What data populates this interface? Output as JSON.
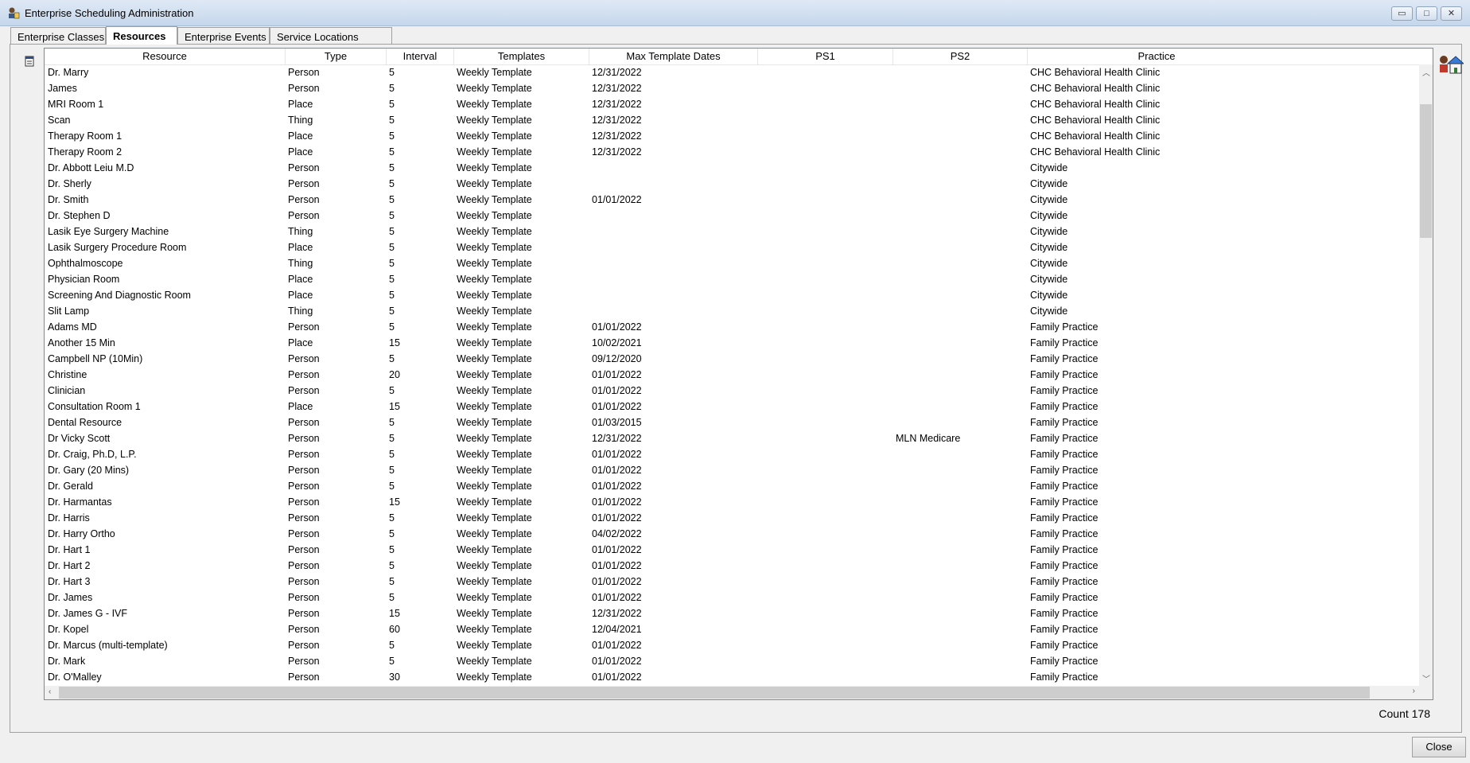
{
  "window": {
    "title": "Enterprise Scheduling Administration",
    "minimize_label": "▭",
    "maximize_label": "□",
    "close_label": "✕"
  },
  "tabs": [
    {
      "label": "Enterprise Classes",
      "active": false
    },
    {
      "label": "Resources",
      "active": true
    },
    {
      "label": "Enterprise Events",
      "active": false
    },
    {
      "label": "Service Locations",
      "active": false
    }
  ],
  "table": {
    "columns": [
      "Resource",
      "Type",
      "Interval",
      "Templates",
      "Max Template Dates",
      "PS1",
      "PS2",
      "Practice"
    ],
    "rows": [
      [
        "Dr. Marry",
        "Person",
        "5",
        "Weekly Template",
        "12/31/2022",
        "",
        "",
        "CHC Behavioral Health Clinic"
      ],
      [
        "James",
        "Person",
        "5",
        "Weekly Template",
        "12/31/2022",
        "",
        "",
        "CHC Behavioral Health Clinic"
      ],
      [
        "MRI Room 1",
        "Place",
        "5",
        "Weekly Template",
        "12/31/2022",
        "",
        "",
        "CHC Behavioral Health Clinic"
      ],
      [
        "Scan",
        "Thing",
        "5",
        "Weekly Template",
        "12/31/2022",
        "",
        "",
        "CHC Behavioral Health Clinic"
      ],
      [
        "Therapy Room 1",
        "Place",
        "5",
        "Weekly Template",
        "12/31/2022",
        "",
        "",
        "CHC Behavioral Health Clinic"
      ],
      [
        "Therapy Room 2",
        "Place",
        "5",
        "Weekly Template",
        "12/31/2022",
        "",
        "",
        "CHC Behavioral Health Clinic"
      ],
      [
        "Dr. Abbott Leiu M.D",
        "Person",
        "5",
        "Weekly Template",
        "",
        "",
        "",
        "Citywide"
      ],
      [
        "Dr. Sherly",
        "Person",
        "5",
        "Weekly Template",
        "",
        "",
        "",
        "Citywide"
      ],
      [
        "Dr. Smith",
        "Person",
        "5",
        "Weekly Template",
        "01/01/2022",
        "",
        "",
        "Citywide"
      ],
      [
        "Dr. Stephen D",
        "Person",
        "5",
        "Weekly Template",
        "",
        "",
        "",
        "Citywide"
      ],
      [
        "Lasik Eye Surgery Machine",
        "Thing",
        "5",
        "Weekly Template",
        "",
        "",
        "",
        "Citywide"
      ],
      [
        "Lasik Surgery Procedure Room",
        "Place",
        "5",
        "Weekly Template",
        "",
        "",
        "",
        "Citywide"
      ],
      [
        "Ophthalmoscope",
        "Thing",
        "5",
        "Weekly Template",
        "",
        "",
        "",
        "Citywide"
      ],
      [
        "Physician Room",
        "Place",
        "5",
        "Weekly Template",
        "",
        "",
        "",
        "Citywide"
      ],
      [
        "Screening And Diagnostic Room",
        "Place",
        "5",
        "Weekly Template",
        "",
        "",
        "",
        "Citywide"
      ],
      [
        "Slit Lamp",
        "Thing",
        "5",
        "Weekly Template",
        "",
        "",
        "",
        "Citywide"
      ],
      [
        "Adams MD",
        "Person",
        "5",
        "Weekly Template",
        "01/01/2022",
        "",
        "",
        "Family Practice"
      ],
      [
        "Another 15 Min",
        "Place",
        "15",
        "Weekly Template",
        "10/02/2021",
        "",
        "",
        "Family Practice"
      ],
      [
        "Campbell NP (10Min)",
        "Person",
        "5",
        "Weekly Template",
        "09/12/2020",
        "",
        "",
        "Family Practice"
      ],
      [
        "Christine",
        "Person",
        "20",
        "Weekly Template",
        "01/01/2022",
        "",
        "",
        "Family Practice"
      ],
      [
        "Clinician",
        "Person",
        "5",
        "Weekly Template",
        "01/01/2022",
        "",
        "",
        "Family Practice"
      ],
      [
        "Consultation Room 1",
        "Place",
        "15",
        "Weekly Template",
        "01/01/2022",
        "",
        "",
        "Family Practice"
      ],
      [
        "Dental Resource",
        "Person",
        "5",
        "Weekly Template",
        "01/03/2015",
        "",
        "",
        "Family Practice"
      ],
      [
        "Dr Vicky Scott",
        "Person",
        "5",
        "Weekly Template",
        "12/31/2022",
        "",
        "MLN Medicare",
        "Family Practice"
      ],
      [
        "Dr. Craig, Ph.D, L.P.",
        "Person",
        "5",
        "Weekly Template",
        "01/01/2022",
        "",
        "",
        "Family Practice"
      ],
      [
        "Dr. Gary (20 Mins)",
        "Person",
        "5",
        "Weekly Template",
        "01/01/2022",
        "",
        "",
        "Family Practice"
      ],
      [
        "Dr. Gerald",
        "Person",
        "5",
        "Weekly Template",
        "01/01/2022",
        "",
        "",
        "Family Practice"
      ],
      [
        "Dr. Harmantas",
        "Person",
        "15",
        "Weekly Template",
        "01/01/2022",
        "",
        "",
        "Family Practice"
      ],
      [
        "Dr. Harris",
        "Person",
        "5",
        "Weekly Template",
        "01/01/2022",
        "",
        "",
        "Family Practice"
      ],
      [
        "Dr. Harry Ortho",
        "Person",
        "5",
        "Weekly Template",
        "04/02/2022",
        "",
        "",
        "Family Practice"
      ],
      [
        "Dr. Hart 1",
        "Person",
        "5",
        "Weekly Template",
        "01/01/2022",
        "",
        "",
        "Family Practice"
      ],
      [
        "Dr. Hart 2",
        "Person",
        "5",
        "Weekly Template",
        "01/01/2022",
        "",
        "",
        "Family Practice"
      ],
      [
        "Dr. Hart 3",
        "Person",
        "5",
        "Weekly Template",
        "01/01/2022",
        "",
        "",
        "Family Practice"
      ],
      [
        "Dr. James",
        "Person",
        "5",
        "Weekly Template",
        "01/01/2022",
        "",
        "",
        "Family Practice"
      ],
      [
        "Dr. James G - IVF",
        "Person",
        "15",
        "Weekly Template",
        "12/31/2022",
        "",
        "",
        "Family Practice"
      ],
      [
        "Dr. Kopel",
        "Person",
        "60",
        "Weekly Template",
        "12/04/2021",
        "",
        "",
        "Family Practice"
      ],
      [
        "Dr. Marcus (multi-template)",
        "Person",
        "5",
        "Weekly Template",
        "01/01/2022",
        "",
        "",
        "Family Practice"
      ],
      [
        "Dr. Mark",
        "Person",
        "5",
        "Weekly Template",
        "01/01/2022",
        "",
        "",
        "Family Practice"
      ],
      [
        "Dr. O'Malley",
        "Person",
        "30",
        "Weekly Template",
        "01/01/2022",
        "",
        "",
        "Family Practice"
      ]
    ]
  },
  "footer": {
    "count_label": "Count 178",
    "close_label": "Close"
  }
}
